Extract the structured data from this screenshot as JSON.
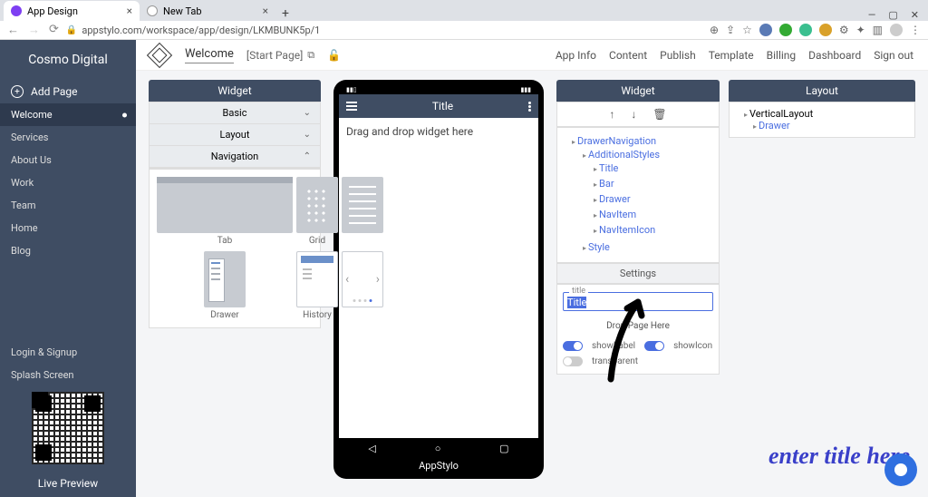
{
  "browser": {
    "tabs": [
      {
        "label": "App Design"
      },
      {
        "label": "New Tab"
      }
    ],
    "url": "appstylo.com/workspace/app/design/LKMBUNK5p/1"
  },
  "sidebar": {
    "brand": "Cosmo Digital",
    "addPage": "Add Page",
    "items": [
      {
        "label": "Welcome"
      },
      {
        "label": "Services"
      },
      {
        "label": "About Us"
      },
      {
        "label": "Work"
      },
      {
        "label": "Team"
      },
      {
        "label": "Home"
      },
      {
        "label": "Blog"
      }
    ],
    "bottom": [
      {
        "label": "Login & Signup"
      },
      {
        "label": "Splash Screen"
      }
    ],
    "livePreview": "Live Preview"
  },
  "topbar": {
    "welcome": "Welcome",
    "startPage": "[Start Page]",
    "nav": [
      "App Info",
      "Content",
      "Publish",
      "Template",
      "Billing",
      "Dashboard",
      "Sign out"
    ]
  },
  "widgetLib": {
    "title": "Widget",
    "sections": [
      {
        "label": "Basic"
      },
      {
        "label": "Layout"
      },
      {
        "label": "Navigation"
      }
    ],
    "items": [
      "Tab",
      "Grid",
      "List",
      "Drawer",
      "History",
      "Swipe"
    ]
  },
  "phone": {
    "title": "Title",
    "placeholder": "Drag and drop widget here",
    "brand": "AppStylo"
  },
  "widgetPanel": {
    "title": "Widget",
    "tree": {
      "root": "DrawerNavigation",
      "children": [
        "AdditionalStyles",
        "Style"
      ],
      "styles": [
        "Title",
        "Bar",
        "Drawer",
        "NavItem",
        "NavItemIcon"
      ]
    },
    "settings": {
      "head": "Settings",
      "titleLabel": "title",
      "titleValue": "Title",
      "drop": "Drop Page Here",
      "toggles": [
        {
          "label": "showLabel",
          "on": true
        },
        {
          "label": "showIcon",
          "on": true
        },
        {
          "label": "transparent",
          "on": false
        }
      ]
    }
  },
  "layoutPanel": {
    "title": "Layout",
    "root": "VerticalLayout",
    "child": "Drawer"
  },
  "annotation": "enter title here"
}
